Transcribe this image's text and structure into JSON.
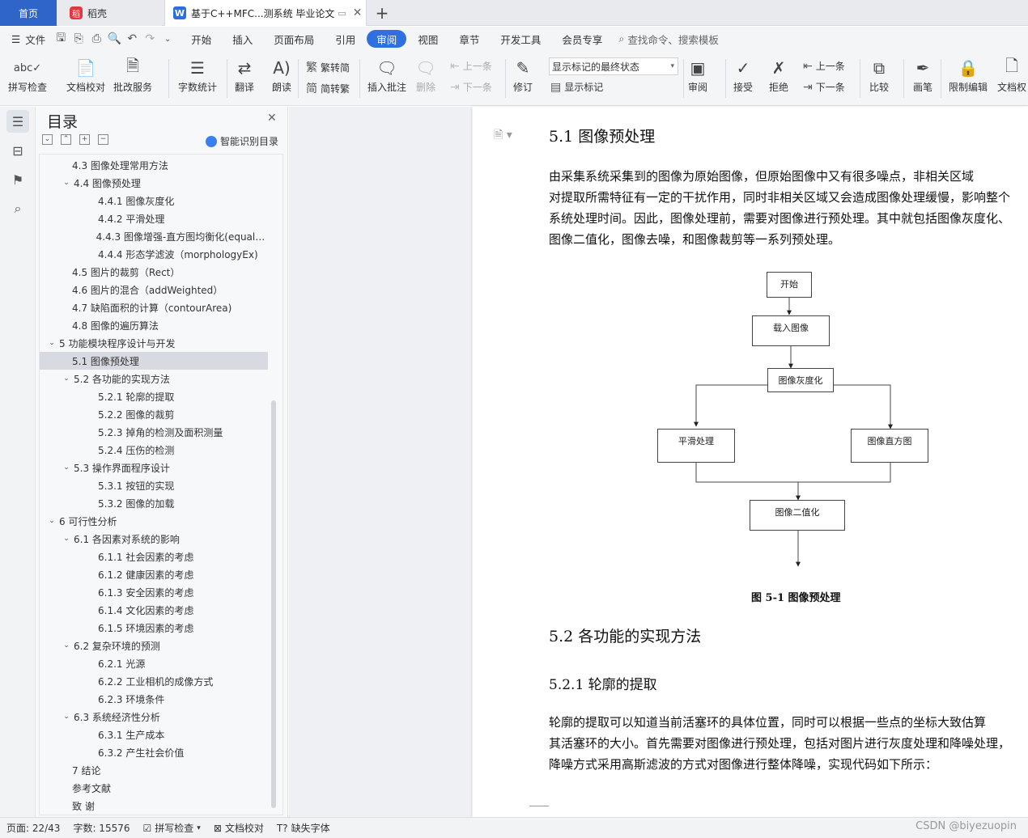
{
  "tabs": {
    "home": "首页",
    "daoke": "稻壳",
    "doc": "基于C++MFC...测系统 毕业论文",
    "new_tab": "+"
  },
  "menu": {
    "file": "文件",
    "items": [
      "开始",
      "插入",
      "页面布局",
      "引用",
      "审阅",
      "视图",
      "章节",
      "开发工具",
      "会员专享"
    ],
    "active": "审阅",
    "search": "查找命令、搜索模板"
  },
  "ribbon": {
    "spellcheck": "拼写检查",
    "doc_proof": "文档校对",
    "batch_service": "批改服务",
    "word_count": "字数统计",
    "translate": "翻译",
    "read_aloud": "朗读",
    "trad_to_simp": "繁转简",
    "simp_to_trad": "简转繁",
    "insert_comment": "插入批注",
    "delete": "删除",
    "prev_comment": "上一条",
    "next_comment": "下一条",
    "track_changes": "修订",
    "markup_state": "显示标记的最终状态",
    "show_markup": "显示标记",
    "review": "审阅",
    "accept": "接受",
    "reject": "拒绝",
    "prev_change": "上一条",
    "next_change": "下一条",
    "compare": "比较",
    "pen": "画笔",
    "restrict_edit": "限制编辑",
    "doc_perm": "文档权"
  },
  "toc": {
    "title": "目录",
    "smart": "智能识别目录",
    "items": [
      {
        "label": "4.3 图像处理常用方法",
        "level": 2,
        "chev": ""
      },
      {
        "label": "4.4 图像预处理",
        "level": 2,
        "chev": "v"
      },
      {
        "label": "4.4.1 图像灰度化",
        "level": 3,
        "chev": ""
      },
      {
        "label": "4.4.2 平滑处理",
        "level": 3,
        "chev": ""
      },
      {
        "label": "4.4.3 图像增强-直方图均衡化(equaliz...",
        "level": 3,
        "chev": ""
      },
      {
        "label": "4.4.4 形态学滤波（morphologyEx)",
        "level": 3,
        "chev": ""
      },
      {
        "label": "4.5 图片的裁剪（Rect）",
        "level": 2,
        "chev": ""
      },
      {
        "label": "4.6 图片的混合（addWeighted）",
        "level": 2,
        "chev": ""
      },
      {
        "label": "4.7 缺陷面积的计算（contourArea)",
        "level": 2,
        "chev": ""
      },
      {
        "label": "4.8 图像的遍历算法",
        "level": 2,
        "chev": ""
      },
      {
        "label": "5  功能模块程序设计与开发",
        "level": 1,
        "chev": "v"
      },
      {
        "label": "5.1 图像预处理",
        "level": 2,
        "chev": "",
        "selected": true
      },
      {
        "label": "5.2 各功能的实现方法",
        "level": 2,
        "chev": "v"
      },
      {
        "label": "5.2.1 轮廓的提取",
        "level": 3,
        "chev": ""
      },
      {
        "label": "5.2.2 图像的裁剪",
        "level": 3,
        "chev": ""
      },
      {
        "label": "5.2.3 掉角的检测及面积测量",
        "level": 3,
        "chev": ""
      },
      {
        "label": "5.2.4 压伤的检测",
        "level": 3,
        "chev": ""
      },
      {
        "label": "5.3 操作界面程序设计",
        "level": 2,
        "chev": "v"
      },
      {
        "label": "5.3.1 按钮的实现",
        "level": 3,
        "chev": ""
      },
      {
        "label": "5.3.2 图像的加载",
        "level": 3,
        "chev": ""
      },
      {
        "label": "6  可行性分析",
        "level": 1,
        "chev": "v"
      },
      {
        "label": "6.1 各因素对系统的影响",
        "level": 2,
        "chev": "v"
      },
      {
        "label": "6.1.1 社会因素的考虑",
        "level": 3,
        "chev": ""
      },
      {
        "label": "6.1.2 健康因素的考虑",
        "level": 3,
        "chev": ""
      },
      {
        "label": "6.1.3 安全因素的考虑",
        "level": 3,
        "chev": ""
      },
      {
        "label": "6.1.4 文化因素的考虑",
        "level": 3,
        "chev": ""
      },
      {
        "label": "6.1.5 环境因素的考虑",
        "level": 3,
        "chev": ""
      },
      {
        "label": "6.2 复杂环境的预测",
        "level": 2,
        "chev": "v"
      },
      {
        "label": "6.2.1 光源",
        "level": 3,
        "chev": ""
      },
      {
        "label": "6.2.2 工业相机的成像方式",
        "level": 3,
        "chev": ""
      },
      {
        "label": "6.2.3 环境条件",
        "level": 3,
        "chev": ""
      },
      {
        "label": "6.3 系统经济性分析",
        "level": 2,
        "chev": "v"
      },
      {
        "label": "6.3.1 生产成本",
        "level": 3,
        "chev": ""
      },
      {
        "label": "6.3.2 产生社会价值",
        "level": 3,
        "chev": ""
      },
      {
        "label": "7  结论",
        "level": 0,
        "chev": ""
      },
      {
        "label": "参考文献",
        "level": 0,
        "chev": ""
      },
      {
        "label": "致    谢",
        "level": 0,
        "chev": ""
      }
    ]
  },
  "doc": {
    "h_51": "5.1 图像预处理",
    "p1": [
      "        由采集系统采集到的图像为原始图像，但原始图像中又有很多噪点，非相关区域",
      "对提取所需特征有一定的干扰作用，同时非相关区域又会造成图像处理缓慢，影响整个",
      "系统处理时间。因此，图像处理前，需要对图像进行预处理。其中就包括图像灰度化、",
      "图像二值化，图像去噪，和图像裁剪等一系列预处理。"
    ],
    "flow": {
      "start": "开始",
      "load": "载入图像",
      "gray": "图像灰度化",
      "smooth": "平滑处理",
      "hist": "图像直方图",
      "binary": "图像二值化"
    },
    "fig_caption": "图 5-1  图像预处理",
    "h_52": "5.2 各功能的实现方法",
    "h_521": "5.2.1 轮廓的提取",
    "p2": [
      "        轮廓的提取可以知道当前活塞环的具体位置，同时可以根据一些点的坐标大致估算",
      "其活塞环的大小。首先需要对图像进行预处理，包括对图片进行灰度处理和降噪处理，",
      "降噪方式采用高斯滤波的方式对图像进行整体降噪，实现代码如下所示："
    ]
  },
  "status": {
    "page": "页面: 22/43",
    "words": "字数: 15576",
    "spell": "拼写检查",
    "proof": "文档校对",
    "missing_font": "缺失字体",
    "watermark": "CSDN @biyezuopin"
  }
}
